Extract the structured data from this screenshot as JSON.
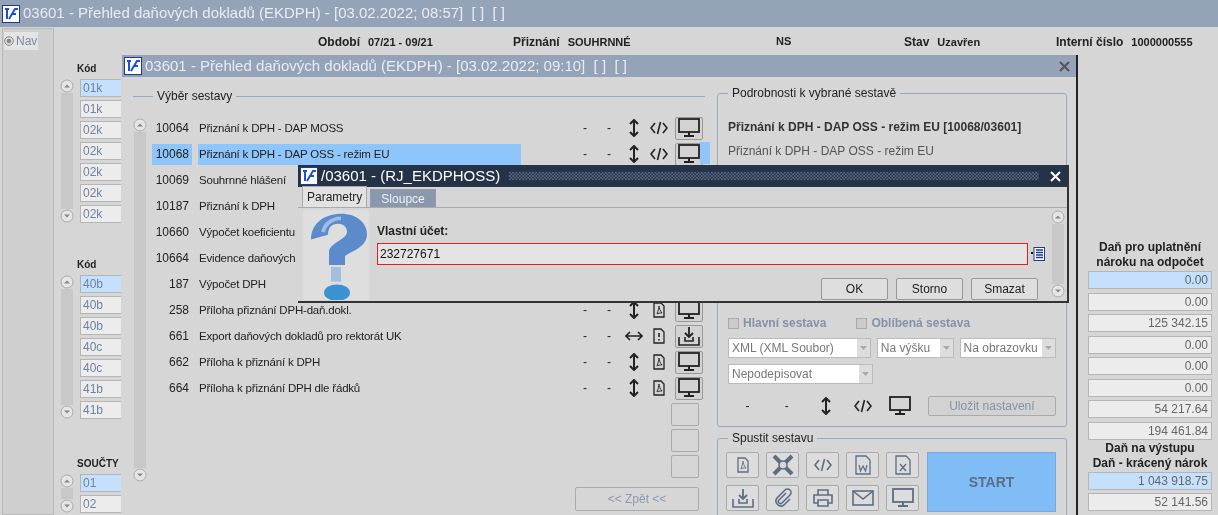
{
  "main_window": {
    "title": "03601 - Přehled daňových dokladů (EKDPH) - [03.02.2022; 08:57]  [ ]  [ ]",
    "nav": {
      "label": "Nav",
      "selected": true
    },
    "header": [
      {
        "label": "Období",
        "value": "07/21 - 09/21"
      },
      {
        "label": "Přiznání",
        "value": "SOUHRNNÉ"
      },
      {
        "value": "NS"
      },
      {
        "label": "Stav",
        "value": "Uzavřen"
      },
      {
        "label": "Interní číslo",
        "value": "1000000555"
      }
    ],
    "code_lists": [
      {
        "heading": "Kód",
        "items": [
          {
            "text": "01k",
            "selected": true
          },
          {
            "text": "01k",
            "selected": false
          },
          {
            "text": "02k",
            "selected": false
          },
          {
            "text": "02k",
            "selected": false
          },
          {
            "text": "02k",
            "selected": false
          },
          {
            "text": "02k",
            "selected": false
          },
          {
            "text": "02k",
            "selected": false
          }
        ]
      },
      {
        "heading": "Kód",
        "items": [
          {
            "text": "40b",
            "selected": true
          },
          {
            "text": "40b",
            "selected": false
          },
          {
            "text": "40b",
            "selected": false
          },
          {
            "text": "40c",
            "selected": false
          },
          {
            "text": "40c",
            "selected": false
          },
          {
            "text": "41b",
            "selected": false
          },
          {
            "text": "41b",
            "selected": false
          }
        ]
      },
      {
        "heading": "SOUČTY",
        "items": [
          {
            "text": "01",
            "selected": true
          },
          {
            "text": "02",
            "selected": false
          }
        ]
      }
    ],
    "tax_groups": [
      {
        "headings": [
          "Daň pro uplatnění",
          "nároku na odpočet"
        ],
        "values": [
          {
            "text": "0.00",
            "selected": true
          },
          {
            "text": "0.00",
            "selected": false
          },
          {
            "text": "125 342.15",
            "selected": false
          },
          {
            "text": "0.00",
            "selected": false
          },
          {
            "text": "0.00",
            "selected": false
          },
          {
            "text": "0.00",
            "selected": false
          },
          {
            "text": "54 217.64",
            "selected": false
          },
          {
            "text": "194 461.84",
            "selected": false
          }
        ]
      },
      {
        "headings": [
          "Daň na výstupu",
          "Daň - krácený nárok"
        ],
        "values": [
          {
            "text": "1 043 918.75",
            "selected": true
          },
          {
            "text": "52 141.56",
            "selected": false
          }
        ]
      }
    ]
  },
  "report_window": {
    "title": "03601 - Přehled daňových dokladů (EKDPH) - [03.02.2022; 09:10]  [ ]  [ ]",
    "selection": {
      "legend": "Výběr sestavy",
      "rows": [
        {
          "number": "10064",
          "name": "Přiznání k DPH - DAP MOSS",
          "selected": false,
          "kind": "xml",
          "dashes": [
            "-",
            "-"
          ]
        },
        {
          "number": "10068",
          "name": "Přiznání k DPH - DAP OSS - režim EU",
          "selected": true,
          "kind": "xml",
          "dashes": [
            "-",
            "-"
          ]
        },
        {
          "number": "10069",
          "name": "Souhrnné hlášení",
          "selected": false
        },
        {
          "number": "10187",
          "name": "Přiznání k DPH",
          "selected": false
        },
        {
          "number": "10660",
          "name": "Výpočet koeficientu",
          "selected": false
        },
        {
          "number": "10664",
          "name": "Evidence daňových",
          "selected": false
        },
        {
          "number": "187",
          "name": "Výpočet DPH",
          "selected": false
        },
        {
          "number": "258",
          "name": "Příloha přiznání DPH-daň.dokl.",
          "selected": false,
          "kind": "pdf",
          "dashes": [
            "-",
            "-"
          ]
        },
        {
          "number": "661",
          "name": "Export daňových dokladů pro rektorát UK",
          "selected": false,
          "kind": "export",
          "dashes": [
            "-",
            "-"
          ]
        },
        {
          "number": "662",
          "name": "Příloha k přiznání k DPH",
          "selected": false,
          "kind": "pdf",
          "dashes": [
            "-",
            "-"
          ]
        },
        {
          "number": "664",
          "name": "Příloha k přiznání DPH dle řádků",
          "selected": false,
          "kind": "pdf",
          "dashes": [
            "-",
            "-"
          ]
        }
      ],
      "back_button": "<< Zpět <<"
    },
    "details": {
      "legend": "Podrobnosti k vybrané sestavě",
      "title": "Přiznání k DPH - DAP OSS - režim EU [10068/03601]",
      "subtitle": "Přiznání k DPH - DAP OSS - režim EU",
      "checkboxes": [
        {
          "label": "Hlavní sestava",
          "checked": false
        },
        {
          "label": "Oblíbená sestava",
          "checked": false
        }
      ],
      "selects": [
        "XML (XML Soubor)",
        "Na výšku",
        "Na obrazovku",
        "Nepodepisovat"
      ],
      "dashes": [
        "-",
        "-"
      ],
      "save_button": "Uložit nastavení"
    },
    "run": {
      "legend": "Spustit sestavu",
      "start_button": "START"
    }
  },
  "dialog": {
    "title": "/03601 - (RJ_EKDPHOSS)",
    "tabs": [
      {
        "label": "Parametry",
        "selected": true,
        "disabled": false
      },
      {
        "label": "Sloupce",
        "selected": false,
        "disabled": true
      }
    ],
    "field": {
      "label": "Vlastní účet:",
      "value": "232727671"
    },
    "buttons": [
      "OK",
      "Storno",
      "Smazat"
    ]
  }
}
